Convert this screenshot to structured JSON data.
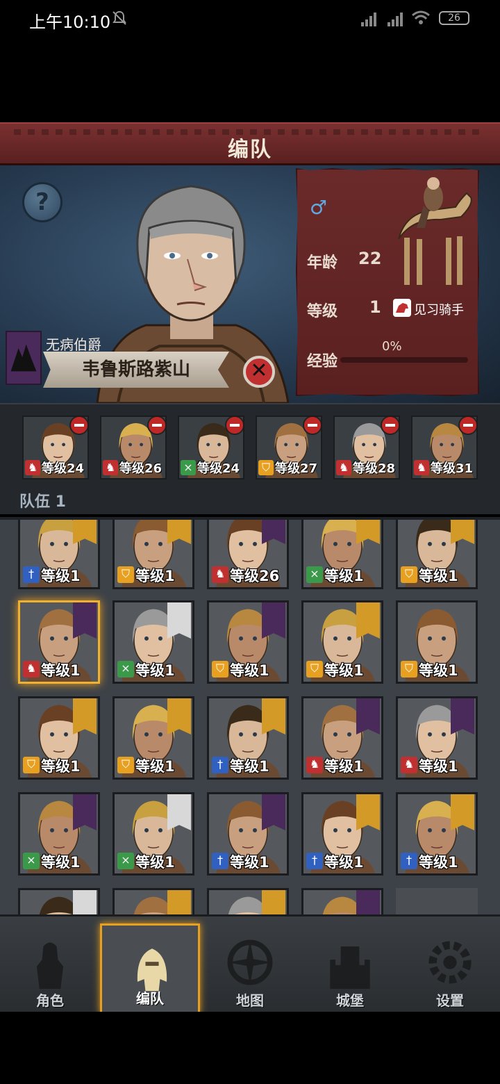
{
  "status_bar": {
    "time": "上午10:10",
    "battery": "26"
  },
  "header": {
    "title": "编队"
  },
  "hero": {
    "house": "无病伯爵",
    "name": "韦鲁斯路紫山",
    "age_label": "年龄",
    "age": "22",
    "level_label": "等级",
    "level": "1",
    "class_name": "见习骑手",
    "xp_label": "经验",
    "xp": "0%"
  },
  "squad": {
    "label": "队伍 1",
    "members": [
      {
        "level": "等级24",
        "cls": "cavalry"
      },
      {
        "level": "等级26",
        "cls": "cavalry"
      },
      {
        "level": "等级24",
        "cls": "archer"
      },
      {
        "level": "等级27",
        "cls": "shield"
      },
      {
        "level": "等级28",
        "cls": "cavalry"
      },
      {
        "level": "等级31",
        "cls": "cavalry"
      }
    ]
  },
  "roster": [
    {
      "level": "等级1",
      "cls": "sword",
      "flag": "gold"
    },
    {
      "level": "等级1",
      "cls": "shield",
      "flag": "gold"
    },
    {
      "level": "等级26",
      "cls": "cavalry",
      "flag": "purple"
    },
    {
      "level": "等级1",
      "cls": "archer",
      "flag": "gold"
    },
    {
      "level": "等级1",
      "cls": "shield",
      "flag": "gold"
    },
    {
      "level": "等级1",
      "cls": "cavalry",
      "flag": "purple",
      "selected": true
    },
    {
      "level": "等级1",
      "cls": "archer",
      "flag": "white"
    },
    {
      "level": "等级1",
      "cls": "shield",
      "flag": "purple"
    },
    {
      "level": "等级1",
      "cls": "shield",
      "flag": "gold"
    },
    {
      "level": "等级1",
      "cls": "shield",
      "flag": "none"
    },
    {
      "level": "等级1",
      "cls": "shield",
      "flag": "gold"
    },
    {
      "level": "等级1",
      "cls": "shield",
      "flag": "gold"
    },
    {
      "level": "等级1",
      "cls": "sword",
      "flag": "gold"
    },
    {
      "level": "等级1",
      "cls": "cavalry",
      "flag": "purple"
    },
    {
      "level": "等级1",
      "cls": "cavalry",
      "flag": "purple"
    },
    {
      "level": "等级1",
      "cls": "archer",
      "flag": "purple"
    },
    {
      "level": "等级1",
      "cls": "archer",
      "flag": "white"
    },
    {
      "level": "等级1",
      "cls": "sword",
      "flag": "purple"
    },
    {
      "level": "等级1",
      "cls": "sword",
      "flag": "gold"
    },
    {
      "level": "等级1",
      "cls": "sword",
      "flag": "gold"
    },
    {
      "level": "",
      "cls": "none",
      "flag": "white"
    },
    {
      "level": "",
      "cls": "none",
      "flag": "gold"
    },
    {
      "level": "",
      "cls": "none",
      "flag": "gold"
    },
    {
      "level": "",
      "cls": "none",
      "flag": "purple"
    }
  ],
  "nav": [
    {
      "label": "角色",
      "icon": "knight-icon"
    },
    {
      "label": "编队",
      "icon": "helmet-icon",
      "active": true
    },
    {
      "label": "地图",
      "icon": "compass-icon"
    },
    {
      "label": "城堡",
      "icon": "castle-icon"
    },
    {
      "label": "设置",
      "icon": "gear-icon"
    }
  ],
  "colors": {
    "cavalry": "#c03030",
    "archer": "#3a9a4a",
    "shield": "#e8a020",
    "sword": "#3060c0",
    "flag_gold": "#d49a28",
    "flag_purple": "#4a2a5a",
    "flag_white": "#d8d8d8"
  }
}
